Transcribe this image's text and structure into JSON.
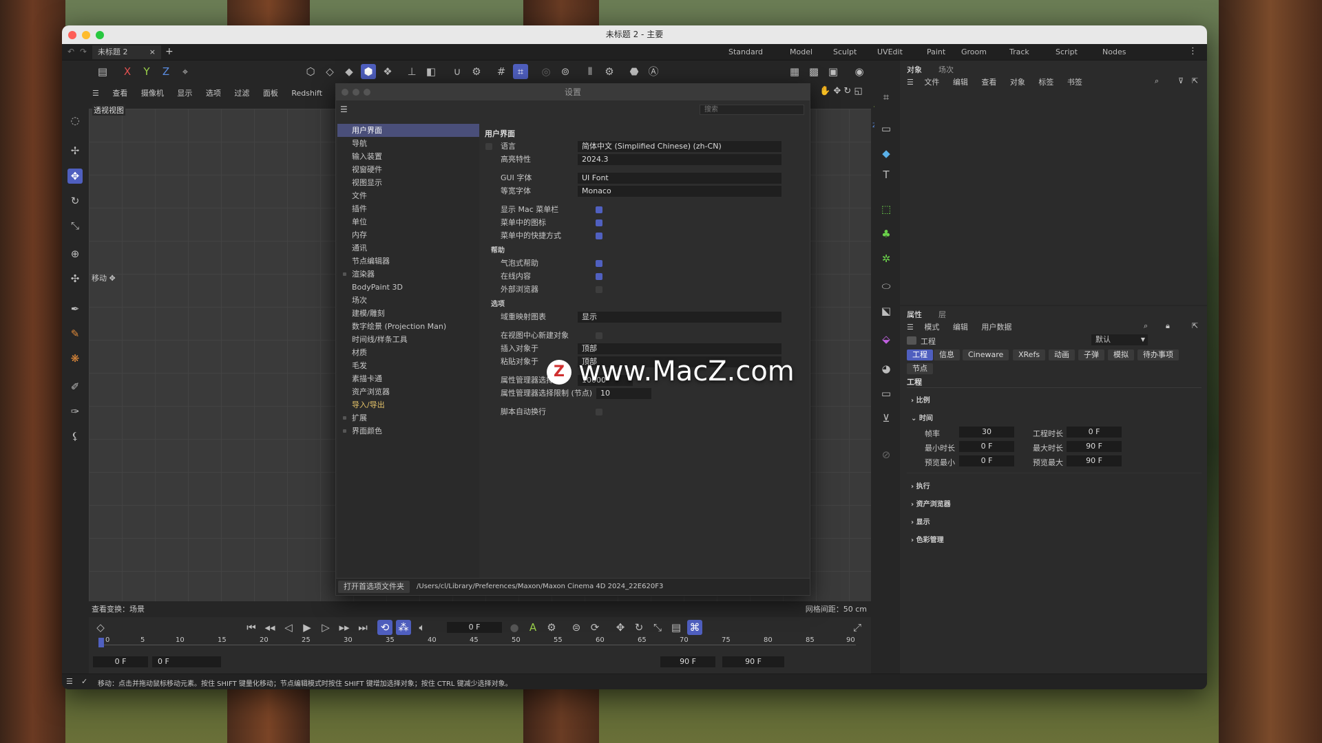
{
  "window": {
    "title": "未标题 2 - 主要"
  },
  "tabs": [
    {
      "label": "未标题 2"
    }
  ],
  "tab_close": "×",
  "tab_add": "+",
  "layouts": [
    "Standard",
    "Model",
    "Sculpt",
    "UVEdit",
    "Paint",
    "Groom",
    "Track",
    "Script",
    "Nodes"
  ],
  "viewport_menu": [
    "查看",
    "摄像机",
    "显示",
    "选项",
    "过滤",
    "面板",
    "Redshift"
  ],
  "viewport": {
    "name": "透视视图",
    "move_label": "移动",
    "view_transform": "查看变换：场景",
    "grid_spacing": "网格间距：50 cm"
  },
  "axis_labels": {
    "x": "X",
    "y": "Y",
    "z": "Z"
  },
  "dialog": {
    "title": "设置",
    "search_placeholder": "搜索",
    "nav": [
      "用户界面",
      "导航",
      "输入装置",
      "视窗硬件",
      "视图显示",
      "文件",
      "插件",
      "单位",
      "内存",
      "通讯",
      "节点编辑器",
      "渲染器",
      "BodyPaint 3D",
      "场次",
      "建模/雕刻",
      "数字绘景 (Projection Man)",
      "时间线/样条工具",
      "材质",
      "毛发",
      "素描卡通",
      "资产浏览器",
      "导入/导出",
      "扩展",
      "界面颜色"
    ],
    "section_title": "用户界面",
    "rows": {
      "language": {
        "label": "语言",
        "value": "简体中文 (Simplified Chinese) (zh-CN)"
      },
      "highlight": {
        "label": "高亮特性",
        "value": "2024.3"
      },
      "gui_font": {
        "label": "GUI 字体",
        "value": "UI Font"
      },
      "mono_font": {
        "label": "等宽字体",
        "value": "Monaco"
      },
      "mac_menubar": {
        "label": "显示 Mac 菜单栏"
      },
      "menu_icons": {
        "label": "菜单中的图标"
      },
      "menu_shortcuts": {
        "label": "菜单中的快捷方式"
      },
      "help_group": "帮助",
      "bubble_help": {
        "label": "气泡式帮助"
      },
      "online_content": {
        "label": "在线内容"
      },
      "external_browser": {
        "label": "外部浏览器"
      },
      "options_group": "选项",
      "domain_map": {
        "label": "域重映射图表",
        "value": "显示"
      },
      "new_obj_center": {
        "label": "在视图中心新建对象"
      },
      "insert_at": {
        "label": "插入对象于",
        "value": "顶部"
      },
      "paste_at": {
        "label": "粘贴对象于",
        "value": "顶部"
      },
      "attr_select_limit": {
        "label": "属性管理器选择限",
        "value": "10000"
      },
      "attr_select_limit_nodes": {
        "label": "属性管理器选择限制 (节点)",
        "value": "10"
      },
      "script_wrap": {
        "label": "脚本自动换行"
      }
    },
    "open_prefs_button": "打开首选项文件夹",
    "prefs_path": "/Users/cl/Library/Preferences/Maxon/Maxon Cinema 4D 2024_22E620F3"
  },
  "watermark": "www.MacZ.com",
  "watermark_badge": "Z",
  "objects_panel": {
    "tabs": [
      "对象",
      "场次"
    ],
    "menu": [
      "文件",
      "编辑",
      "查看",
      "对象",
      "标签",
      "书签"
    ]
  },
  "attributes_panel": {
    "tabs": [
      "属性",
      "层"
    ],
    "menu": [
      "模式",
      "编辑",
      "用户数据"
    ],
    "object_label": "工程",
    "preset": "默认",
    "prop_tabs": [
      "工程",
      "信息",
      "Cineware",
      "XRefs",
      "动画",
      "子弹",
      "模拟",
      "待办事项",
      "节点"
    ],
    "heading": "工程",
    "sections": [
      "比例",
      "时间",
      "执行",
      "资产浏览器",
      "显示",
      "色彩管理"
    ],
    "fields": {
      "fps": {
        "label": "帧率",
        "value": "30"
      },
      "proj_len": {
        "label": "工程时长",
        "value": "0 F"
      },
      "min_len": {
        "label": "最小时长",
        "value": "0 F"
      },
      "max_len": {
        "label": "最大时长",
        "value": "90 F"
      },
      "prev_min": {
        "label": "预览最小",
        "value": "0 F"
      },
      "prev_max": {
        "label": "预览最大",
        "value": "90 F"
      }
    }
  },
  "timeline": {
    "current_frame": "0 F",
    "ticks": [
      "0",
      "5",
      "10",
      "15",
      "20",
      "25",
      "30",
      "35",
      "40",
      "45",
      "50",
      "55",
      "60",
      "65",
      "70",
      "75",
      "80",
      "85",
      "90"
    ],
    "start": "0 F",
    "start2": "0 F",
    "end": "90 F",
    "end2": "90 F",
    "auto_key_label": "A"
  },
  "status_bar": "移动：点击并拖动鼠标移动元素。按住 SHIFT 键量化移动；节点编辑模式时按住 SHIFT 键增加选择对象；按住 CTRL 键减少选择对象。"
}
